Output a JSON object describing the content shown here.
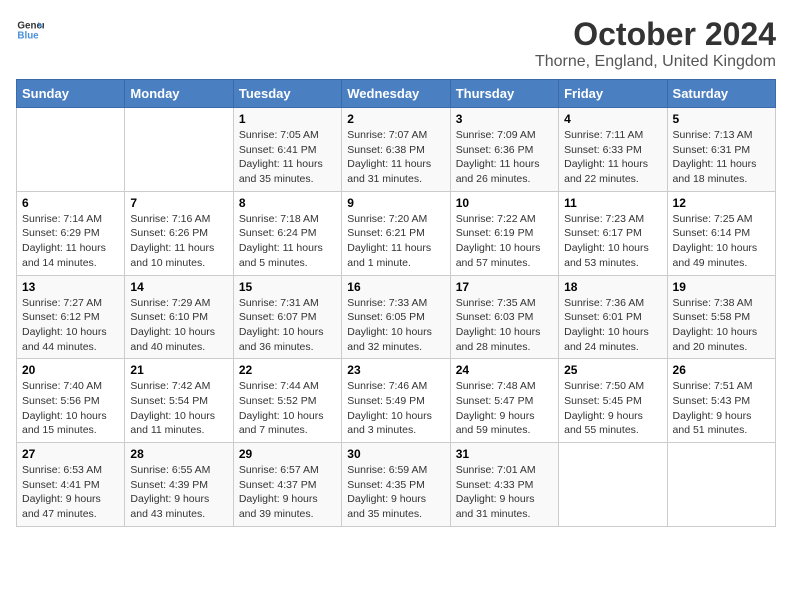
{
  "logo": {
    "text_general": "General",
    "text_blue": "Blue"
  },
  "header": {
    "title": "October 2024",
    "subtitle": "Thorne, England, United Kingdom"
  },
  "weekdays": [
    "Sunday",
    "Monday",
    "Tuesday",
    "Wednesday",
    "Thursday",
    "Friday",
    "Saturday"
  ],
  "weeks": [
    [
      {
        "day": "",
        "sunrise": "",
        "sunset": "",
        "daylight": ""
      },
      {
        "day": "",
        "sunrise": "",
        "sunset": "",
        "daylight": ""
      },
      {
        "day": "1",
        "sunrise": "Sunrise: 7:05 AM",
        "sunset": "Sunset: 6:41 PM",
        "daylight": "Daylight: 11 hours and 35 minutes."
      },
      {
        "day": "2",
        "sunrise": "Sunrise: 7:07 AM",
        "sunset": "Sunset: 6:38 PM",
        "daylight": "Daylight: 11 hours and 31 minutes."
      },
      {
        "day": "3",
        "sunrise": "Sunrise: 7:09 AM",
        "sunset": "Sunset: 6:36 PM",
        "daylight": "Daylight: 11 hours and 26 minutes."
      },
      {
        "day": "4",
        "sunrise": "Sunrise: 7:11 AM",
        "sunset": "Sunset: 6:33 PM",
        "daylight": "Daylight: 11 hours and 22 minutes."
      },
      {
        "day": "5",
        "sunrise": "Sunrise: 7:13 AM",
        "sunset": "Sunset: 6:31 PM",
        "daylight": "Daylight: 11 hours and 18 minutes."
      }
    ],
    [
      {
        "day": "6",
        "sunrise": "Sunrise: 7:14 AM",
        "sunset": "Sunset: 6:29 PM",
        "daylight": "Daylight: 11 hours and 14 minutes."
      },
      {
        "day": "7",
        "sunrise": "Sunrise: 7:16 AM",
        "sunset": "Sunset: 6:26 PM",
        "daylight": "Daylight: 11 hours and 10 minutes."
      },
      {
        "day": "8",
        "sunrise": "Sunrise: 7:18 AM",
        "sunset": "Sunset: 6:24 PM",
        "daylight": "Daylight: 11 hours and 5 minutes."
      },
      {
        "day": "9",
        "sunrise": "Sunrise: 7:20 AM",
        "sunset": "Sunset: 6:21 PM",
        "daylight": "Daylight: 11 hours and 1 minute."
      },
      {
        "day": "10",
        "sunrise": "Sunrise: 7:22 AM",
        "sunset": "Sunset: 6:19 PM",
        "daylight": "Daylight: 10 hours and 57 minutes."
      },
      {
        "day": "11",
        "sunrise": "Sunrise: 7:23 AM",
        "sunset": "Sunset: 6:17 PM",
        "daylight": "Daylight: 10 hours and 53 minutes."
      },
      {
        "day": "12",
        "sunrise": "Sunrise: 7:25 AM",
        "sunset": "Sunset: 6:14 PM",
        "daylight": "Daylight: 10 hours and 49 minutes."
      }
    ],
    [
      {
        "day": "13",
        "sunrise": "Sunrise: 7:27 AM",
        "sunset": "Sunset: 6:12 PM",
        "daylight": "Daylight: 10 hours and 44 minutes."
      },
      {
        "day": "14",
        "sunrise": "Sunrise: 7:29 AM",
        "sunset": "Sunset: 6:10 PM",
        "daylight": "Daylight: 10 hours and 40 minutes."
      },
      {
        "day": "15",
        "sunrise": "Sunrise: 7:31 AM",
        "sunset": "Sunset: 6:07 PM",
        "daylight": "Daylight: 10 hours and 36 minutes."
      },
      {
        "day": "16",
        "sunrise": "Sunrise: 7:33 AM",
        "sunset": "Sunset: 6:05 PM",
        "daylight": "Daylight: 10 hours and 32 minutes."
      },
      {
        "day": "17",
        "sunrise": "Sunrise: 7:35 AM",
        "sunset": "Sunset: 6:03 PM",
        "daylight": "Daylight: 10 hours and 28 minutes."
      },
      {
        "day": "18",
        "sunrise": "Sunrise: 7:36 AM",
        "sunset": "Sunset: 6:01 PM",
        "daylight": "Daylight: 10 hours and 24 minutes."
      },
      {
        "day": "19",
        "sunrise": "Sunrise: 7:38 AM",
        "sunset": "Sunset: 5:58 PM",
        "daylight": "Daylight: 10 hours and 20 minutes."
      }
    ],
    [
      {
        "day": "20",
        "sunrise": "Sunrise: 7:40 AM",
        "sunset": "Sunset: 5:56 PM",
        "daylight": "Daylight: 10 hours and 15 minutes."
      },
      {
        "day": "21",
        "sunrise": "Sunrise: 7:42 AM",
        "sunset": "Sunset: 5:54 PM",
        "daylight": "Daylight: 10 hours and 11 minutes."
      },
      {
        "day": "22",
        "sunrise": "Sunrise: 7:44 AM",
        "sunset": "Sunset: 5:52 PM",
        "daylight": "Daylight: 10 hours and 7 minutes."
      },
      {
        "day": "23",
        "sunrise": "Sunrise: 7:46 AM",
        "sunset": "Sunset: 5:49 PM",
        "daylight": "Daylight: 10 hours and 3 minutes."
      },
      {
        "day": "24",
        "sunrise": "Sunrise: 7:48 AM",
        "sunset": "Sunset: 5:47 PM",
        "daylight": "Daylight: 9 hours and 59 minutes."
      },
      {
        "day": "25",
        "sunrise": "Sunrise: 7:50 AM",
        "sunset": "Sunset: 5:45 PM",
        "daylight": "Daylight: 9 hours and 55 minutes."
      },
      {
        "day": "26",
        "sunrise": "Sunrise: 7:51 AM",
        "sunset": "Sunset: 5:43 PM",
        "daylight": "Daylight: 9 hours and 51 minutes."
      }
    ],
    [
      {
        "day": "27",
        "sunrise": "Sunrise: 6:53 AM",
        "sunset": "Sunset: 4:41 PM",
        "daylight": "Daylight: 9 hours and 47 minutes."
      },
      {
        "day": "28",
        "sunrise": "Sunrise: 6:55 AM",
        "sunset": "Sunset: 4:39 PM",
        "daylight": "Daylight: 9 hours and 43 minutes."
      },
      {
        "day": "29",
        "sunrise": "Sunrise: 6:57 AM",
        "sunset": "Sunset: 4:37 PM",
        "daylight": "Daylight: 9 hours and 39 minutes."
      },
      {
        "day": "30",
        "sunrise": "Sunrise: 6:59 AM",
        "sunset": "Sunset: 4:35 PM",
        "daylight": "Daylight: 9 hours and 35 minutes."
      },
      {
        "day": "31",
        "sunrise": "Sunrise: 7:01 AM",
        "sunset": "Sunset: 4:33 PM",
        "daylight": "Daylight: 9 hours and 31 minutes."
      },
      {
        "day": "",
        "sunrise": "",
        "sunset": "",
        "daylight": ""
      },
      {
        "day": "",
        "sunrise": "",
        "sunset": "",
        "daylight": ""
      }
    ]
  ]
}
